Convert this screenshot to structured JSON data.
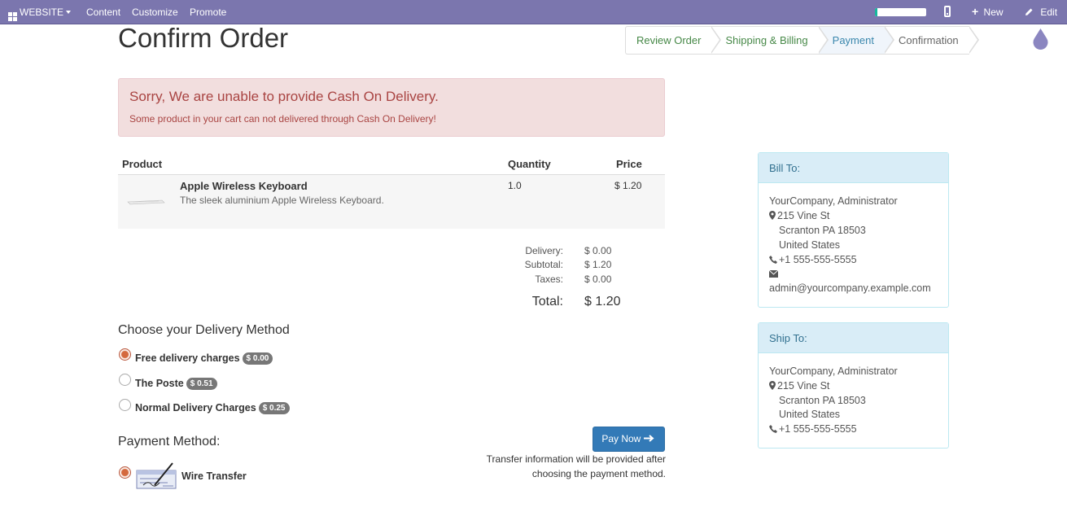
{
  "topbar": {
    "website_label": "WEBSITE",
    "content_label": "Content",
    "customize_label": "Customize",
    "promote_label": "Promote",
    "progress_fraction": 0.05,
    "new_label": "New",
    "edit_label": "Edit"
  },
  "page": {
    "title": "Confirm Order"
  },
  "wizard": {
    "steps": [
      {
        "label": "Review Order"
      },
      {
        "label": "Shipping & Billing"
      },
      {
        "label": "Payment"
      },
      {
        "label": "Confirmation"
      }
    ]
  },
  "alert": {
    "heading": "Sorry, We are unable to provide Cash On Delivery.",
    "message": "Some product in your cart can not delivered through Cash On Delivery!"
  },
  "table": {
    "headers": {
      "product": "Product",
      "quantity": "Quantity",
      "price": "Price"
    },
    "rows": [
      {
        "name": "Apple Wireless Keyboard",
        "description": "The sleek aluminium Apple Wireless Keyboard.",
        "quantity": "1.0",
        "price": "$ 1.20"
      }
    ]
  },
  "summary": {
    "delivery_label": "Delivery:",
    "delivery_value": "$ 0.00",
    "subtotal_label": "Subtotal:",
    "subtotal_value": "$ 1.20",
    "taxes_label": "Taxes:",
    "taxes_value": "$ 0.00",
    "total_label": "Total:",
    "total_value": "$ 1.20"
  },
  "delivery": {
    "heading": "Choose your Delivery Method",
    "options": [
      {
        "label": "Free delivery charges",
        "price": "$ 0.00"
      },
      {
        "label": "The Poste",
        "price": "$ 0.51"
      },
      {
        "label": "Normal Delivery Charges",
        "price": "$ 0.25"
      }
    ]
  },
  "payment": {
    "heading": "Payment Method:",
    "method_label": "Wire Transfer",
    "pay_button": "Pay Now",
    "info_line1": "Transfer information will be provided after",
    "info_line2": "choosing the payment method."
  },
  "bill_to": {
    "heading": "Bill To:",
    "name": "YourCompany, Administrator",
    "street": "215 Vine St",
    "city": "Scranton PA 18503",
    "country": "United States",
    "phone": "+1 555-555-5555",
    "email": "admin@yourcompany.example.com"
  },
  "ship_to": {
    "heading": "Ship To:",
    "name": "YourCompany, Administrator",
    "street": "215 Vine St",
    "city": "Scranton PA 18503",
    "country": "United States",
    "phone": "+1 555-555-5555"
  },
  "colors": {
    "topbar": "#7b76ae",
    "step_done": "#468847",
    "step_active": "#3a87ad",
    "alert_text": "#a94442",
    "primary_button": "#337ab7",
    "radio_selected": "#d4693e"
  }
}
